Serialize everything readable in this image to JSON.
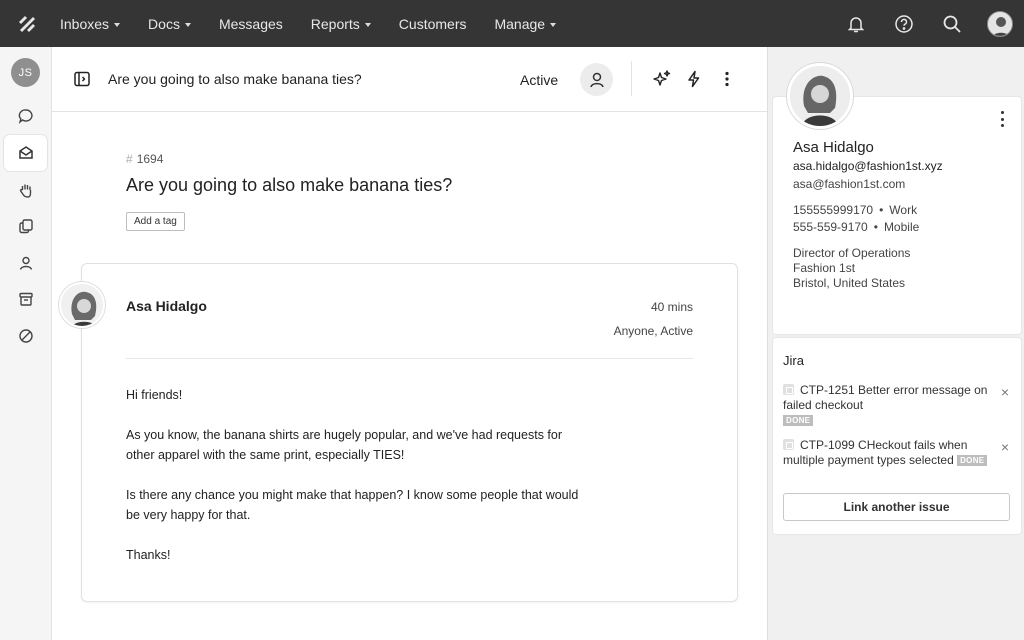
{
  "nav": {
    "items": [
      {
        "label": "Inboxes",
        "dropdown": true
      },
      {
        "label": "Docs",
        "dropdown": true
      },
      {
        "label": "Messages",
        "dropdown": false
      },
      {
        "label": "Reports",
        "dropdown": true
      },
      {
        "label": "Customers",
        "dropdown": false
      },
      {
        "label": "Manage",
        "dropdown": true
      }
    ],
    "right_icons": [
      "bell-icon",
      "help-icon",
      "search-icon",
      "user-avatar"
    ]
  },
  "rail": {
    "avatar_initials": "JS",
    "icons": [
      "chat-icon",
      "inbox-icon",
      "hand-icon",
      "docs-icon",
      "person-icon",
      "archive-icon",
      "block-icon"
    ],
    "active_index": 1
  },
  "header": {
    "title": "Are you going to also make banana ties?",
    "status": "Active"
  },
  "conversation": {
    "number": "1694",
    "hash": "#",
    "subject": "Are you going to also make banana ties?",
    "tag_button": "Add a tag"
  },
  "message": {
    "author": "Asa Hidalgo",
    "time": "40 mins",
    "status": "Anyone, Active",
    "paragraphs": [
      "Hi friends!",
      "As you know, the banana shirts are hugely popular, and we've had requests for other apparel with the same print, especially TIES!",
      "Is there any chance you might make that happen? I know some people that would be very happy for that.",
      "Thanks!"
    ]
  },
  "customer": {
    "name": "Asa Hidalgo",
    "email_primary": "asa.hidalgo@fashion1st.xyz",
    "email_secondary": "asa@fashion1st.com",
    "phones": [
      {
        "number": "155555999170",
        "sep": "•",
        "type": "Work"
      },
      {
        "number": "555-559-9170",
        "sep": "•",
        "type": "Mobile"
      }
    ],
    "job_title": "Director of Operations",
    "company": "Fashion 1st",
    "location": "Bristol, United States"
  },
  "jira": {
    "title": "Jira",
    "issues": [
      {
        "text": "CTP-1251 Better error message on failed checkout",
        "status": "DONE"
      },
      {
        "text": "CTP-1099 CHeckout fails when multiple payment types selected",
        "status": "DONE"
      }
    ],
    "remove_label": "×",
    "link_button": "Link another issue"
  }
}
